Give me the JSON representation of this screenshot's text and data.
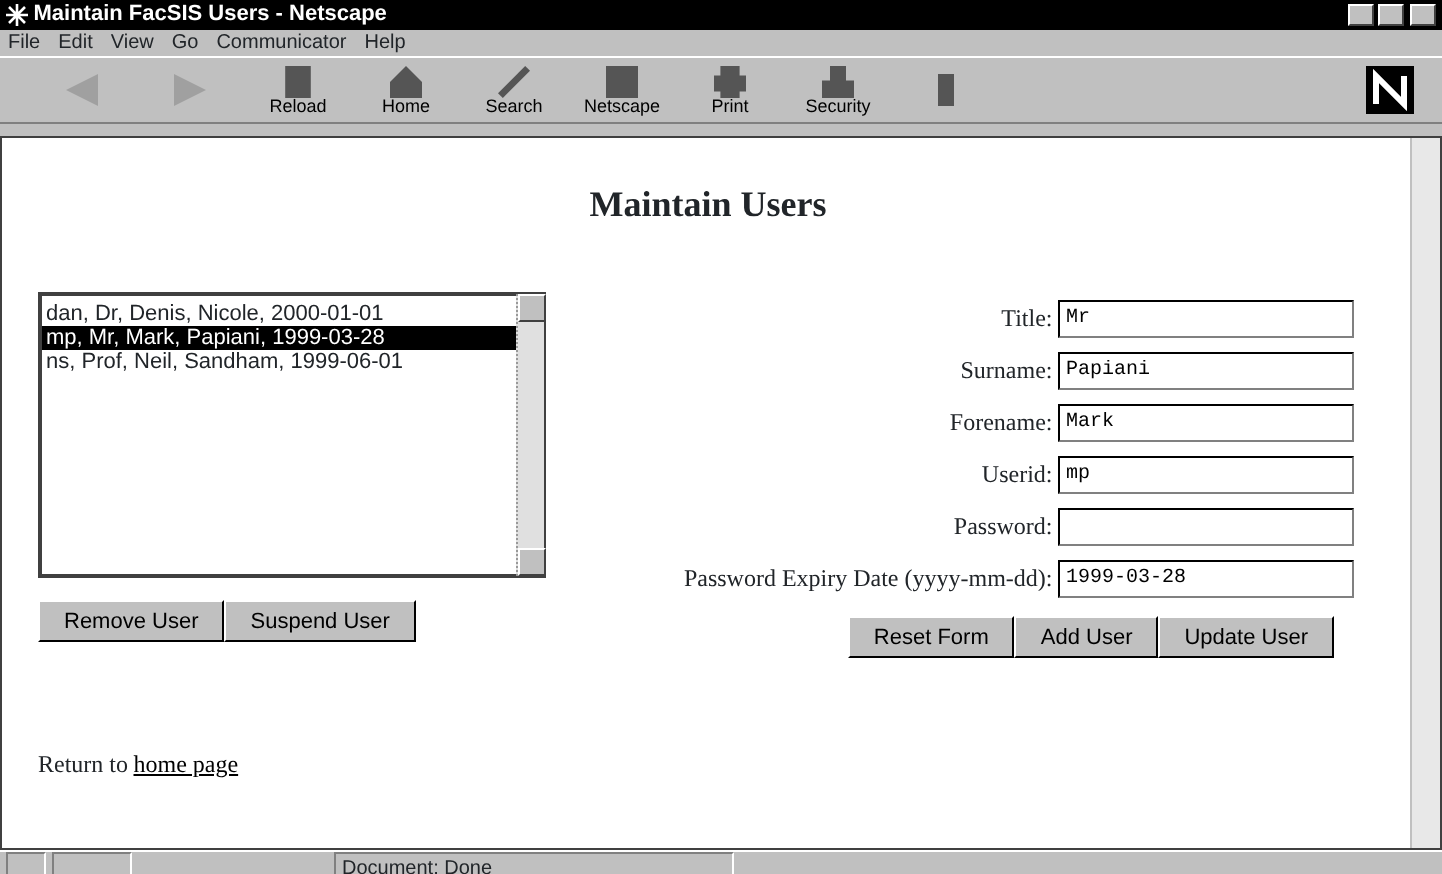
{
  "window": {
    "title": "Maintain FacSIS Users - Netscape"
  },
  "menu": [
    "File",
    "Edit",
    "View",
    "Go",
    "Communicator",
    "Help"
  ],
  "toolbar": [
    {
      "disabled": true
    },
    {
      "disabled": true
    },
    {
      "label": "Reload",
      "disabled": false
    },
    {
      "label": "Home",
      "disabled": false
    },
    {
      "label": "Search",
      "disabled": false
    },
    {
      "label": "Netscape",
      "disabled": false
    },
    {
      "label": "Print",
      "disabled": false
    },
    {
      "label": "Security",
      "disabled": false
    },
    {
      "disabled": false
    }
  ],
  "heading": "Maintain Users",
  "users": [
    {
      "text": "dan, Dr, Denis, Nicole, 2000-01-01",
      "selected": false
    },
    {
      "text": "mp, Mr, Mark, Papiani, 1999-03-28",
      "selected": true
    },
    {
      "text": "ns, Prof, Neil, Sandham, 1999-06-01",
      "selected": false
    }
  ],
  "list_buttons": [
    "Remove User",
    "Suspend User"
  ],
  "fields": [
    {
      "label": "Title:",
      "value": "Mr"
    },
    {
      "label": "Surname:",
      "value": "Papiani"
    },
    {
      "label": "Forename:",
      "value": "Mark"
    },
    {
      "label": "Userid:",
      "value": "mp"
    },
    {
      "label": "Password:"
    },
    {
      "label": "Password Expiry Date (yyyy-mm-dd):",
      "value": "1999-03-28"
    }
  ],
  "form_buttons": [
    "Reset Form",
    "Add User",
    "Update User"
  ],
  "footer": {
    "text": "Return to",
    "link": "home page"
  },
  "status_bar": {
    "text": "Document: Done"
  }
}
